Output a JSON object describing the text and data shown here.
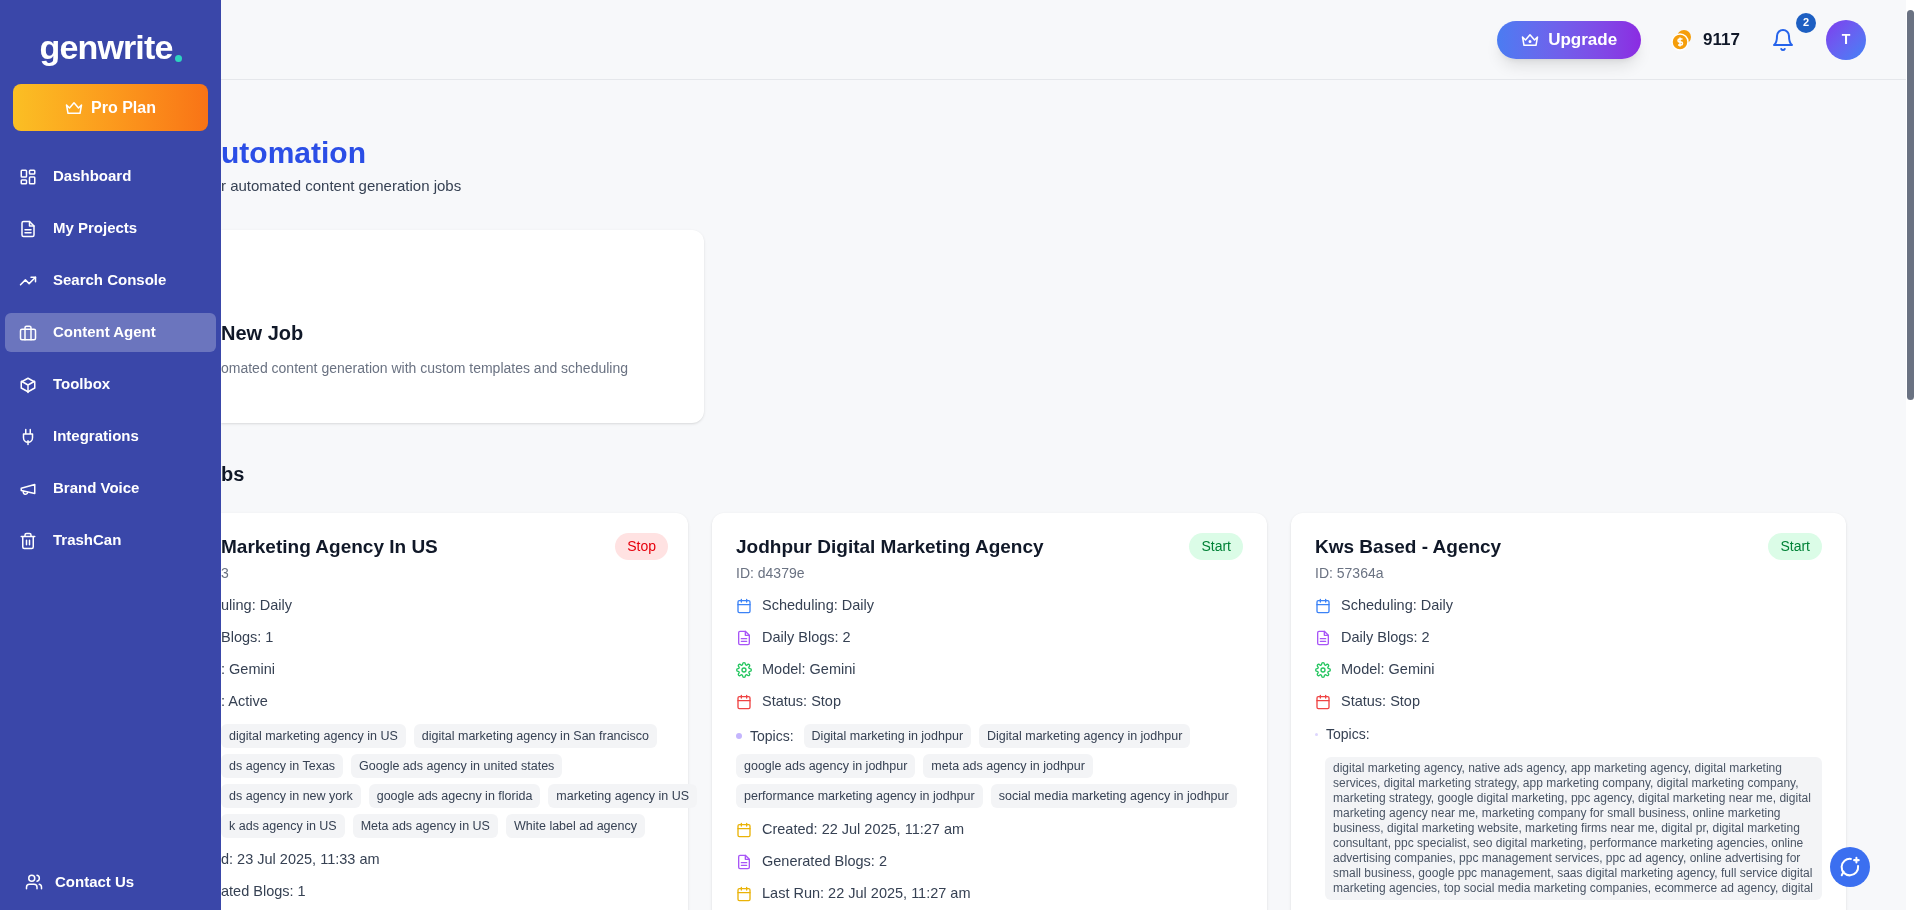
{
  "sidebar": {
    "logo": "genwrite",
    "plan_button": "Pro Plan",
    "items": [
      {
        "label": "Dashboard",
        "selected": false
      },
      {
        "label": "My Projects",
        "selected": false
      },
      {
        "label": "Search Console",
        "selected": false
      },
      {
        "label": "Content Agent",
        "selected": true
      },
      {
        "label": "Toolbox",
        "selected": false
      },
      {
        "label": "Integrations",
        "selected": false
      },
      {
        "label": "Brand Voice",
        "selected": false
      },
      {
        "label": "TrashCan",
        "selected": false
      }
    ],
    "contact": "Contact Us"
  },
  "header": {
    "upgrade": "Upgrade",
    "credits": "9117",
    "notifications": "2",
    "avatar": "T"
  },
  "page": {
    "title": "utomation",
    "subtitle": "r automated content generation jobs"
  },
  "new_job_card": {
    "title": "New Job",
    "description": "omated content generation with custom templates and scheduling"
  },
  "section_title": "bs",
  "jobs": [
    {
      "title": "Marketing Agency In US",
      "id": "3",
      "action": {
        "label": "Stop",
        "kind": "stop"
      },
      "rows": [
        {
          "kind": "plain",
          "text": "uling: Daily"
        },
        {
          "kind": "plain",
          "text": "Blogs: 1"
        },
        {
          "kind": "plain",
          "text": ": Gemini"
        },
        {
          "kind": "plain",
          "text": ": Active"
        },
        {
          "kind": "topics",
          "tag_lines": [
            [
              "digital marketing agency in US",
              "digital marketing agency in San francisco"
            ],
            [
              "ds agency in Texas",
              "Google ads agency in united states"
            ],
            [
              "ds agency in new york",
              "google ads agecny in florida",
              "marketing agency in US"
            ],
            [
              "k ads agency in US",
              "Meta ads agency in US",
              "White label ad agency"
            ]
          ]
        },
        {
          "kind": "plain",
          "text": "d: 23 Jul 2025, 11:33 am"
        },
        {
          "kind": "plain",
          "text": "ated Blogs: 1"
        }
      ]
    },
    {
      "title": "Jodhpur Digital Marketing Agency",
      "id": "ID: d4379e",
      "action": {
        "label": "Start",
        "kind": "start"
      },
      "rows": [
        {
          "kind": "schedule",
          "text": "Scheduling: Daily"
        },
        {
          "kind": "blogs",
          "text": "Daily Blogs: 2"
        },
        {
          "kind": "model",
          "text": "Model: Gemini"
        },
        {
          "kind": "status",
          "text": "Status: Stop"
        },
        {
          "kind": "topics",
          "label": "Topics:",
          "tags": [
            "Digital marketing in jodhpur",
            "Digital marketing agency in jodhpur",
            "google ads agency in jodhpur",
            "meta ads agency in jodhpur",
            "performance marketing agency in jodhpur",
            "social media marketing agency in jodhpur"
          ]
        },
        {
          "kind": "created",
          "text": "Created: 22 Jul 2025, 11:27 am"
        },
        {
          "kind": "blogs",
          "text": "Generated Blogs: 2"
        },
        {
          "kind": "created",
          "text": "Last Run: 22 Jul 2025, 11:27 am"
        }
      ]
    },
    {
      "title": "Kws Based - Agency",
      "id": "ID: 57364a",
      "action": {
        "label": "Start",
        "kind": "start"
      },
      "rows": [
        {
          "kind": "schedule",
          "text": "Scheduling: Daily"
        },
        {
          "kind": "blogs",
          "text": "Daily Blogs: 2"
        },
        {
          "kind": "model",
          "text": "Model: Gemini"
        },
        {
          "kind": "status",
          "text": "Status: Stop"
        },
        {
          "kind": "topics",
          "label": "Topics:",
          "text": "digital marketing agency, native ads agency, app marketing agency, digital marketing services, digital marketing strategy, app marketing company, digital marketing company, marketing strategy, google digital marketing, ppc agency, digital marketing near me, digital marketing agency near me, marketing company for small business, online marketing business, digital marketing website, marketing firms near me, digital pr, digital marketing consultant, ppc specialist, seo digital marketing, performance marketing agencies, online advertising companies, ppc management services, ppc ad agency, online advertising for small business, google ppc management, saas digital marketing agency, full service digital marketing agencies, top social media marketing companies, ecommerce ad agency, digital"
        }
      ]
    }
  ]
}
